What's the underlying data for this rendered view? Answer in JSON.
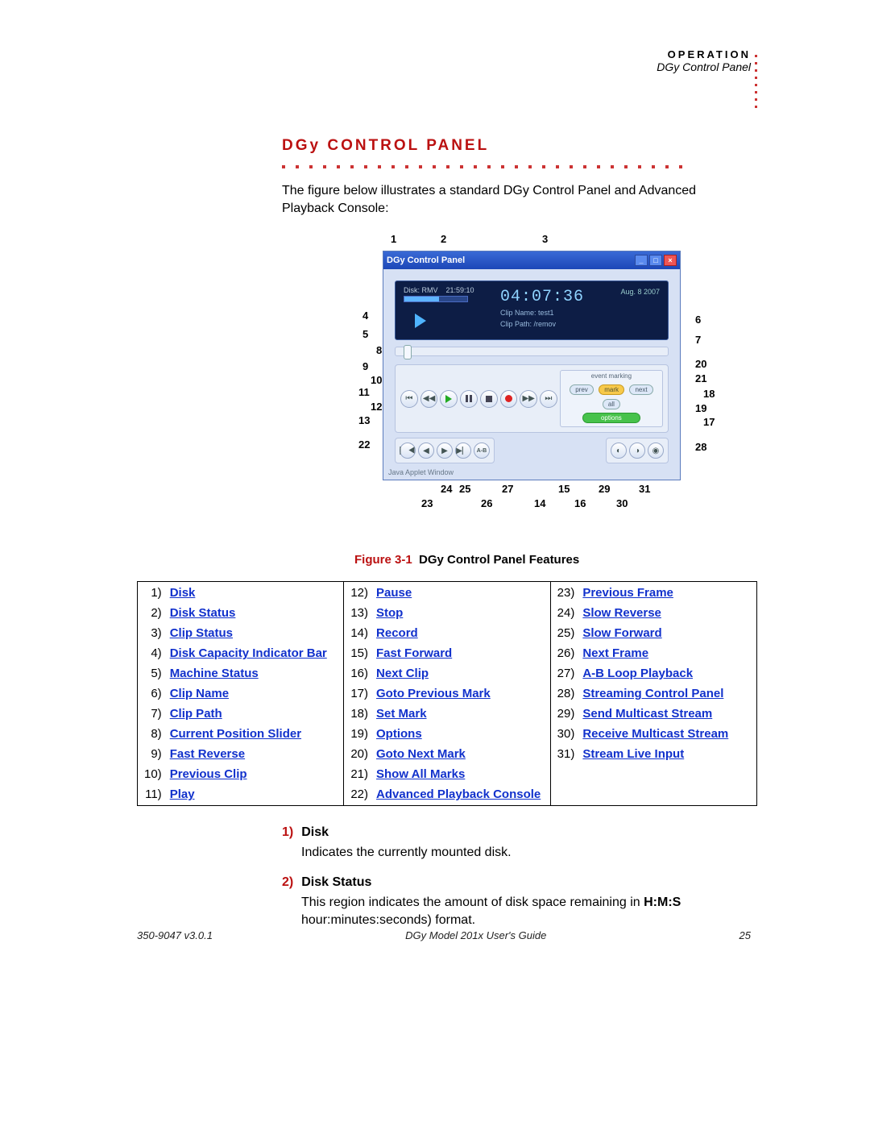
{
  "header": {
    "section": "OPERATION",
    "subsection": "DGy Control Panel"
  },
  "title": "DGy CONTROL PANEL",
  "intro": "The figure below illustrates a standard DGy Control Panel and Advanced Playback Console:",
  "panel": {
    "window_title": "DGy Control Panel",
    "disk_label": "Disk:",
    "disk_value": "RMV",
    "disk_time": "21:59:10",
    "clip_time": "04:07:36",
    "date": "Aug. 8  2007",
    "clipname_label": "Clip Name:",
    "clipname_value": "test1",
    "clippath_label": "Clip Path:",
    "clippath_value": "/remov",
    "event_label": "event marking",
    "pill_prev": "prev",
    "pill_mark": "mark",
    "pill_next": "next",
    "pill_all": "all",
    "pill_options": "options",
    "ab_label": "A-B",
    "applet_text": "Java Applet Window"
  },
  "callouts_top": {
    "c1": "1",
    "c2": "2",
    "c3": "3"
  },
  "callouts_left": {
    "c4": "4",
    "c5": "5",
    "c8": "8",
    "c9": "9",
    "c10": "10",
    "c11": "11",
    "c12": "12",
    "c13": "13",
    "c22": "22"
  },
  "callouts_right": {
    "c6": "6",
    "c7": "7",
    "c20": "20",
    "c21": "21",
    "c18": "18",
    "c19": "19",
    "c17": "17",
    "c28": "28"
  },
  "callouts_bottom": {
    "c23": "23",
    "c24": "24",
    "c25": "25",
    "c26": "26",
    "c27": "27",
    "c14": "14",
    "c15": "15",
    "c16": "16",
    "c29": "29",
    "c30": "30",
    "c31": "31"
  },
  "figure": {
    "num": "Figure 3-1",
    "title": "DGy Control Panel Features"
  },
  "legend": [
    {
      "n": "1)",
      "t": "Disk"
    },
    {
      "n": "2)",
      "t": "Disk Status"
    },
    {
      "n": "3)",
      "t": "Clip Status"
    },
    {
      "n": "4)",
      "t": "Disk Capacity Indicator Bar"
    },
    {
      "n": "5)",
      "t": "Machine Status"
    },
    {
      "n": "6)",
      "t": "Clip Name"
    },
    {
      "n": "7)",
      "t": "Clip Path"
    },
    {
      "n": "8)",
      "t": "Current Position Slider"
    },
    {
      "n": "9)",
      "t": "Fast Reverse"
    },
    {
      "n": "10)",
      "t": "Previous Clip"
    },
    {
      "n": "11)",
      "t": "Play"
    },
    {
      "n": "12)",
      "t": "Pause"
    },
    {
      "n": "13)",
      "t": "Stop"
    },
    {
      "n": "14)",
      "t": "Record"
    },
    {
      "n": "15)",
      "t": "Fast Forward"
    },
    {
      "n": "16)",
      "t": "Next Clip"
    },
    {
      "n": "17)",
      "t": "Goto Previous Mark"
    },
    {
      "n": "18)",
      "t": "Set Mark"
    },
    {
      "n": "19)",
      "t": "Options"
    },
    {
      "n": "20)",
      "t": "Goto Next Mark"
    },
    {
      "n": "21)",
      "t": "Show All Marks"
    },
    {
      "n": "22)",
      "t": "Advanced Playback Console"
    },
    {
      "n": "23)",
      "t": "Previous Frame"
    },
    {
      "n": "24)",
      "t": "Slow Reverse"
    },
    {
      "n": "25)",
      "t": "Slow Forward"
    },
    {
      "n": "26)",
      "t": "Next Frame"
    },
    {
      "n": "27)",
      "t": "A-B Loop Playback"
    },
    {
      "n": "28)",
      "t": "Streaming Control Panel"
    },
    {
      "n": "29)",
      "t": "Send Multicast Stream"
    },
    {
      "n": "30)",
      "t": "Receive Multicast Stream"
    },
    {
      "n": "31)",
      "t": "Stream Live Input"
    }
  ],
  "desc": {
    "h1n": "1)",
    "h1t": "Disk",
    "p1": "Indicates the currently mounted disk.",
    "h2n": "2)",
    "h2t": "Disk Status",
    "p2a": "This region indicates the amount of disk space remaining in ",
    "p2b": "H:M:S",
    "p2c": " hour:minutes:seconds) format."
  },
  "footer": {
    "left": "350-9047 v3.0.1",
    "center": "DGy Model 201x User's Guide",
    "right": "25"
  }
}
